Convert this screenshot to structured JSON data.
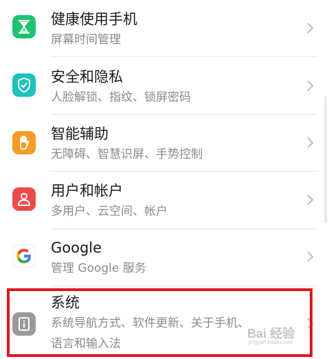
{
  "settings": {
    "items": [
      {
        "title": "健康使用手机",
        "subtitle": "屏幕时间管理",
        "icon": "hourglass-icon",
        "icon_color": "#1fc270"
      },
      {
        "title": "安全和隐私",
        "subtitle": "人脸解锁、指纹、锁屏密码",
        "icon": "shield-check-icon",
        "icon_color": "#1fbfbd"
      },
      {
        "title": "智能辅助",
        "subtitle": "无障碍、智慧识屏、手势控制",
        "icon": "hand-icon",
        "icon_color": "#f79b2a"
      },
      {
        "title": "用户和帐户",
        "subtitle": "多用户、云空间、帐户",
        "icon": "user-icon",
        "icon_color": "#ef4a4a"
      },
      {
        "title": "Google",
        "subtitle": "管理 Google 服务",
        "icon": "google-icon",
        "icon_color": "#ffffff"
      },
      {
        "title": "系统",
        "subtitle_line1": "系统导航方式、软件更新、关于手机、",
        "subtitle_line2": "语言和输入法",
        "icon": "system-info-icon",
        "icon_color": "#9a9a9a"
      }
    ]
  },
  "highlight": {
    "color": "#e0141b"
  },
  "watermark": {
    "text": "Bai 经验",
    "sub": "jingyan.baidu.com"
  }
}
